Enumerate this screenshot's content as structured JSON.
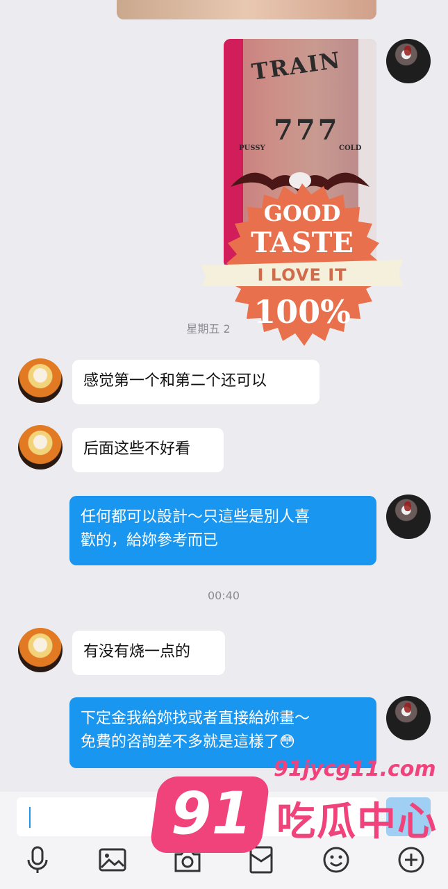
{
  "chat": {
    "timestamps": [
      "星期五 2",
      "00:40"
    ],
    "messages": [
      {
        "side": "in",
        "text": "感觉第一个和第二个还可以"
      },
      {
        "side": "in",
        "text": "后面这些不好看"
      },
      {
        "side": "out",
        "line1": "任何都可以設計～只這些是別人喜",
        "line2": "歡的，給妳參考而已"
      },
      {
        "side": "in",
        "text": "有没有烧一点的"
      },
      {
        "side": "out",
        "line1": "下定金我給妳找或者直接給妳畫～",
        "line2": "免費的咨詢差不多就是這樣了",
        "emoji": "😳"
      }
    ]
  },
  "photo": {
    "tattoo_top": "TRAIN",
    "tattoo_mid": "777",
    "tattoo_left": "PUSSY",
    "tattoo_right": "COLD"
  },
  "sticker": {
    "line1": "GOOD",
    "line2": "TASTE",
    "ribbon": "I LOVE IT",
    "percent": "100%",
    "colors": {
      "seal": "#e8704c",
      "ribbon": "#f4f0dc",
      "text": "#ffffff"
    }
  },
  "input": {
    "placeholder": ""
  },
  "toolbar": {
    "icons": [
      "microphone-icon",
      "image-icon",
      "camera-icon",
      "red-packet-icon",
      "emoji-icon",
      "plus-icon"
    ]
  },
  "watermark": {
    "number": "91",
    "domain": "91jycg11.com",
    "name": "吃瓜中心",
    "color": "#f0437c"
  }
}
